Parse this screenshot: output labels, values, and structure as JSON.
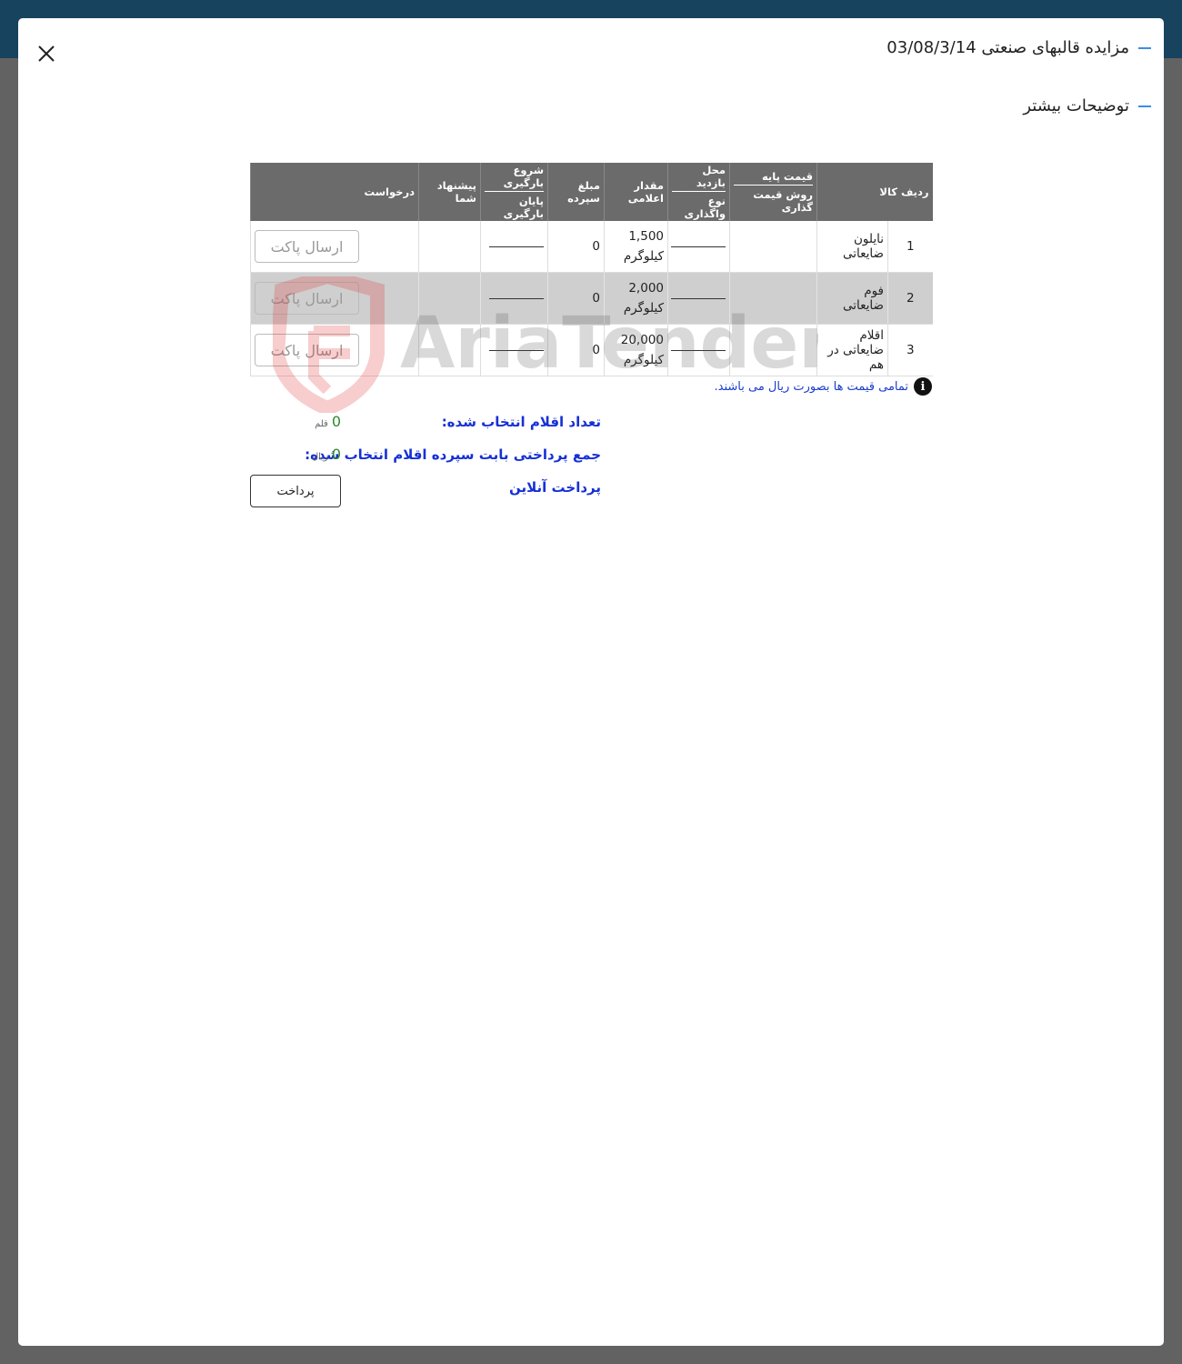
{
  "modal": {
    "title": "مزایده قالبهای صنعتی 03/08/3/14",
    "more_info": "توضیحات بیشتر"
  },
  "table": {
    "headers": {
      "row_no": "ردیف",
      "item": "کالا",
      "base_price": "قیمت پایه",
      "pricing_method": "روش قیمت گذاری",
      "visit_place": "محل بازدید",
      "assign_type": "نوع واگذاری",
      "declared_qty": "مقدار اعلامی",
      "deposit": "مبلغ سپرده",
      "load_start": "شروع بارگیری",
      "load_end": "پایان بارگیری",
      "your_offer": "پیشنهاد شما",
      "request": "درخواست"
    },
    "rows": [
      {
        "no": "1",
        "item": "نایلون ضایعاتی",
        "qty": "1,500",
        "unit": "کیلوگرم",
        "deposit": "0",
        "button": "ارسال پاکت"
      },
      {
        "no": "2",
        "item": "فوم ضایعاتی",
        "qty": "2,000",
        "unit": "کیلوگرم",
        "deposit": "0",
        "button": "ارسال پاکت"
      },
      {
        "no": "3",
        "item": "اقلام ضایعاتی در هم",
        "qty": "20,000",
        "unit": "کیلوگرم",
        "deposit": "0",
        "button": "ارسال پاکت"
      }
    ]
  },
  "watermark": "AriaTender.neT",
  "note": "تمامی قیمت ها بصورت ریال می باشند.",
  "summary": {
    "count_label": "تعداد اقلام انتخاب شده:",
    "count_value": "0",
    "count_unit": "قلم",
    "sum_label": "جمع پرداختی بابت سپرده اقلام انتخاب شده:",
    "sum_value": "0",
    "sum_unit": "ریال",
    "online_label": "پرداخت آنلاین",
    "pay_button": "پرداخت"
  },
  "colors": {
    "topbar": "#17435e",
    "accent": "#3a8ee6",
    "label_blue": "#1630d6",
    "value_green": "#2d8a2d",
    "header_gray": "#6b6b6b"
  }
}
